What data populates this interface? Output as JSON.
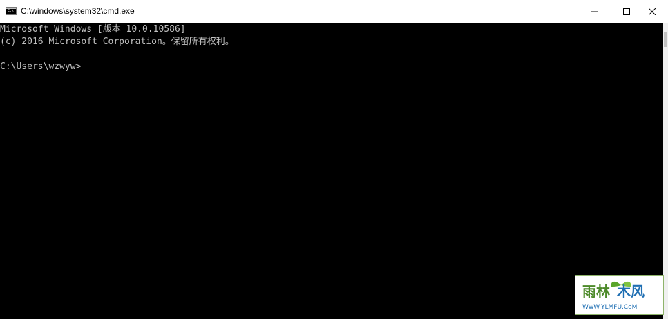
{
  "window": {
    "title": "C:\\windows\\system32\\cmd.exe",
    "app_icon_text": "C:\\",
    "controls": {
      "minimize": "minimize-icon",
      "maximize": "maximize-icon",
      "close": "close-icon"
    }
  },
  "console": {
    "lines": [
      "Microsoft Windows [版本 10.0.10586]",
      "(c) 2016 Microsoft Corporation。保留所有权利。",
      "C:\\Users\\wzwyw>"
    ]
  },
  "watermark": {
    "logo_text": "雨林木风",
    "url_text": "WwW.YLMFU.CoM"
  },
  "colors": {
    "console_bg": "#000000",
    "console_text": "#c0c0c0",
    "titlebar_bg": "#ffffff",
    "watermark_green": "#4d8a2a",
    "watermark_blue": "#1f6fb3"
  }
}
